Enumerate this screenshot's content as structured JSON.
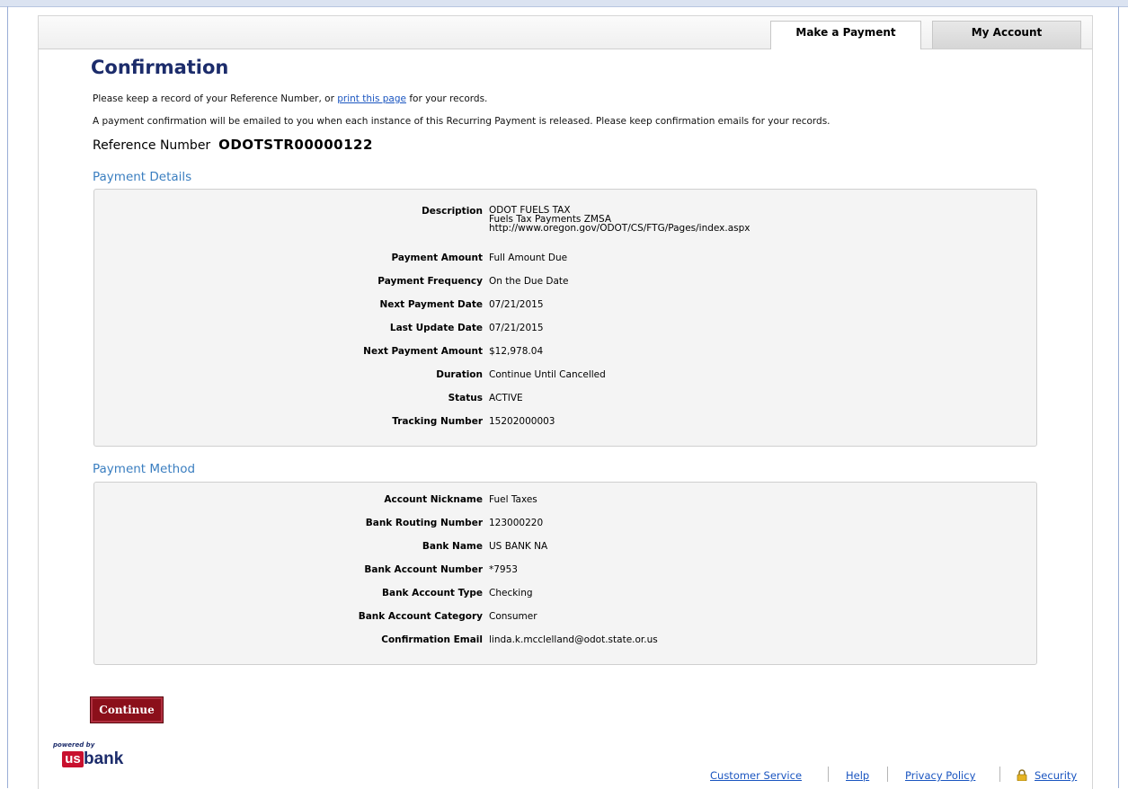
{
  "tabs": [
    {
      "label": "Make a Payment",
      "active": true
    },
    {
      "label": "My Account",
      "active": false
    }
  ],
  "page_title": "Confirmation",
  "intro": {
    "line1_prefix": "Please keep a record of your Reference Number, or ",
    "print_link": "print this page",
    "line1_suffix": " for your records.",
    "line2": "A payment confirmation will be emailed to you when each instance of this Recurring Payment is released. Please keep confirmation emails for your records."
  },
  "reference": {
    "label": "Reference Number",
    "value": "ODOTSTR00000122"
  },
  "payment_details": {
    "title": "Payment Details",
    "description": {
      "label": "Description",
      "lines": [
        "ODOT FUELS TAX",
        "Fuels Tax Payments ZMSA",
        "http://www.oregon.gov/ODOT/CS/FTG/Pages/index.aspx"
      ]
    },
    "rows": [
      {
        "label": "Payment Amount",
        "value": "Full Amount Due"
      },
      {
        "label": "Payment Frequency",
        "value": "On the Due Date"
      },
      {
        "label": "Next Payment Date",
        "value": "07/21/2015"
      },
      {
        "label": "Last Update Date",
        "value": "07/21/2015"
      },
      {
        "label": "Next Payment Amount",
        "value": "$12,978.04"
      },
      {
        "label": "Duration",
        "value": "Continue Until Cancelled"
      },
      {
        "label": "Status",
        "value": "ACTIVE"
      },
      {
        "label": "Tracking Number",
        "value": "15202000003"
      }
    ]
  },
  "payment_method": {
    "title": "Payment Method",
    "rows": [
      {
        "label": "Account Nickname",
        "value": "Fuel Taxes"
      },
      {
        "label": "Bank Routing Number",
        "value": "123000220"
      },
      {
        "label": "Bank Name",
        "value": "US BANK NA"
      },
      {
        "label": "Bank Account Number",
        "value": "*7953"
      },
      {
        "label": "Bank Account Type",
        "value": "Checking"
      },
      {
        "label": "Bank Account Category",
        "value": "Consumer"
      },
      {
        "label": "Confirmation Email",
        "value": "linda.k.mcclelland@odot.state.or.us"
      }
    ]
  },
  "continue_label": "Continue",
  "logo": {
    "powered_by": "powered by",
    "us": "us",
    "bank": "bank"
  },
  "footer": {
    "customer_service": "Customer Service",
    "help": "Help",
    "privacy_policy": "Privacy Policy",
    "security": "Security",
    "security_icon": "lock-icon"
  },
  "colors": {
    "title": "#1c2c6b",
    "section_title": "#3a7ec0",
    "link": "#1a55c0",
    "button": "#8b0f1a",
    "logo_red": "#c8102e"
  }
}
